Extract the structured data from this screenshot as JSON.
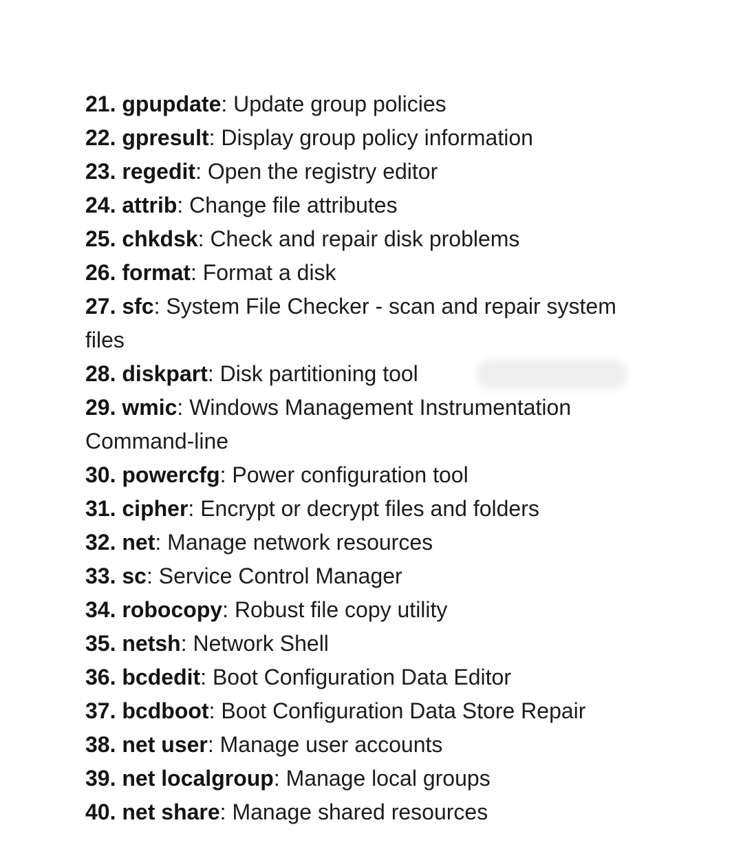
{
  "commands": [
    {
      "num": "21.",
      "cmd": "gpupdate",
      "desc": "Update group policies"
    },
    {
      "num": "22.",
      "cmd": "gpresult",
      "desc": "Display group policy information"
    },
    {
      "num": "23.",
      "cmd": "regedit",
      "desc": "Open the registry editor"
    },
    {
      "num": "24.",
      "cmd": "attrib",
      "desc": "Change file attributes"
    },
    {
      "num": "25.",
      "cmd": "chkdsk",
      "desc": "Check and repair disk problems"
    },
    {
      "num": "26.",
      "cmd": "format",
      "desc": "Format a disk"
    },
    {
      "num": "27.",
      "cmd": "sfc",
      "desc": "System File Checker - scan and repair system files"
    },
    {
      "num": "28.",
      "cmd": "diskpart",
      "desc": "Disk partitioning tool"
    },
    {
      "num": "29.",
      "cmd": "wmic",
      "desc": "Windows Management Instrumentation Command-line"
    },
    {
      "num": "30.",
      "cmd": "powercfg",
      "desc": "Power configuration tool"
    },
    {
      "num": "31.",
      "cmd": "cipher",
      "desc": "Encrypt or decrypt files and folders"
    },
    {
      "num": "32.",
      "cmd": "net",
      "desc": "Manage network resources"
    },
    {
      "num": "33.",
      "cmd": "sc",
      "desc": "Service Control Manager"
    },
    {
      "num": "34.",
      "cmd": "robocopy",
      "desc": "Robust file copy utility"
    },
    {
      "num": "35.",
      "cmd": "netsh",
      "desc": "Network Shell"
    },
    {
      "num": "36.",
      "cmd": "bcdedit",
      "desc": "Boot Configuration Data Editor"
    },
    {
      "num": "37.",
      "cmd": "bcdboot",
      "desc": "Boot Configuration Data Store Repair"
    },
    {
      "num": "38.",
      "cmd": "net user",
      "desc": "Manage user accounts"
    },
    {
      "num": "39.",
      "cmd": "net localgroup",
      "desc": "Manage local groups"
    },
    {
      "num": "40.",
      "cmd": "net share",
      "desc": "Manage shared resources"
    }
  ]
}
